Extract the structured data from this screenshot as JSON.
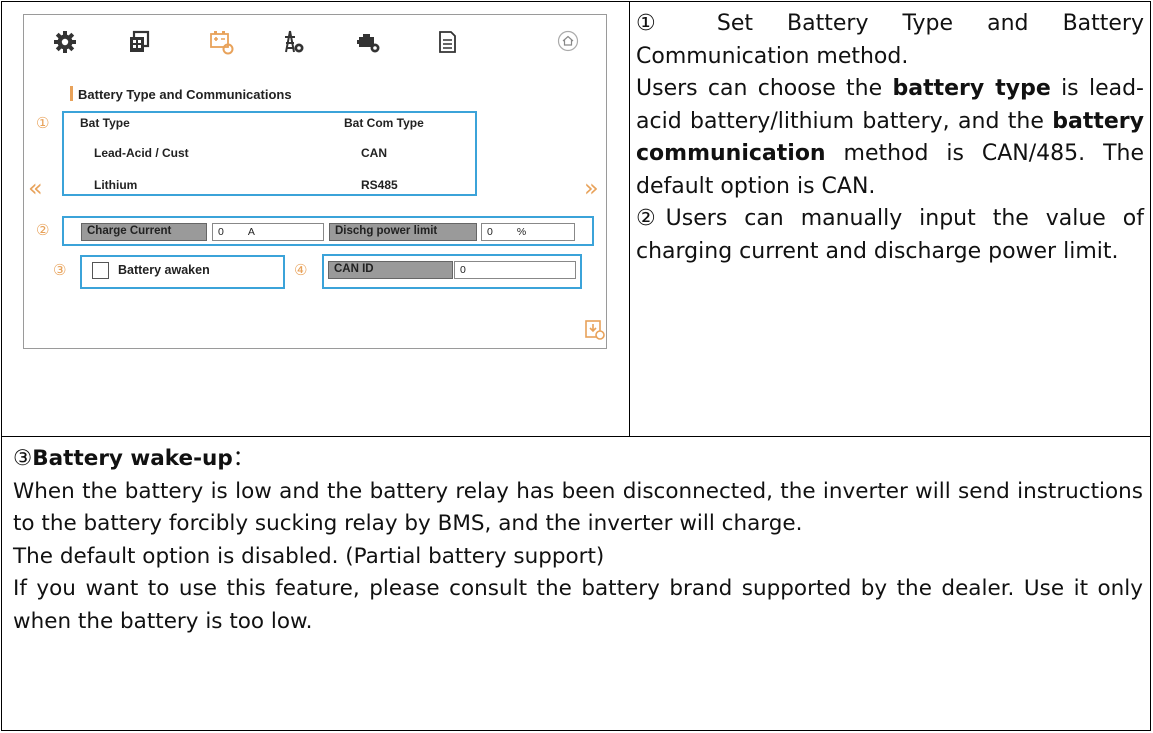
{
  "ui": {
    "toolbar_icons": [
      "gear-icon",
      "grid-settings-icon",
      "battery-settings-icon",
      "grid-tower-icon",
      "generator-icon",
      "document-icon"
    ],
    "home_icon": "home-icon",
    "section_title": "Battery Type and Communications",
    "markers": [
      "①",
      "②",
      "③",
      "④"
    ],
    "bat_type_header": "Bat Type",
    "bat_com_type_header": "Bat Com Type",
    "bat_type_options": [
      "Lead-Acid / Cust",
      "Lithium"
    ],
    "bat_com_options": [
      "CAN",
      "RS485"
    ],
    "nav_prev": "«",
    "nav_next": "»",
    "charge_current_label": "Charge Current",
    "charge_current_value": "0",
    "charge_current_unit": "A",
    "dischg_label": "Dischg power limit",
    "dischg_value": "0",
    "dischg_unit": "%",
    "battery_awaken_label": "Battery awaken",
    "battery_awaken_checked": false,
    "can_id_label": "CAN ID",
    "can_id_value": "0",
    "accent_color": "#e8a25a",
    "highlight_color": "#3ba3d9"
  },
  "text": {
    "r1": "① Set Battery Type and Battery Communication method.",
    "r2_a": "Users can choose the ",
    "r2_b": "battery type",
    "r2_c": " is lead-acid battery/lithium battery, and the ",
    "r2_d": "battery communication",
    "r2_e": " method is CAN/485. The default option is CAN.",
    "r3": "②Users can manually input the value of charging current and discharge power limit.",
    "b1_num": "③",
    "b1_title": "Battery wake-up",
    "b1_colon": "：",
    "b2": "When the battery is low and the battery relay has been disconnected, the inverter will send instructions to the battery forcibly sucking relay by BMS, and the inverter will charge.",
    "b3": "The default option is disabled. (Partial battery support)",
    "b4": "If you want to use this feature, please consult the battery brand supported by the dealer. Use it only when the battery is too low."
  }
}
